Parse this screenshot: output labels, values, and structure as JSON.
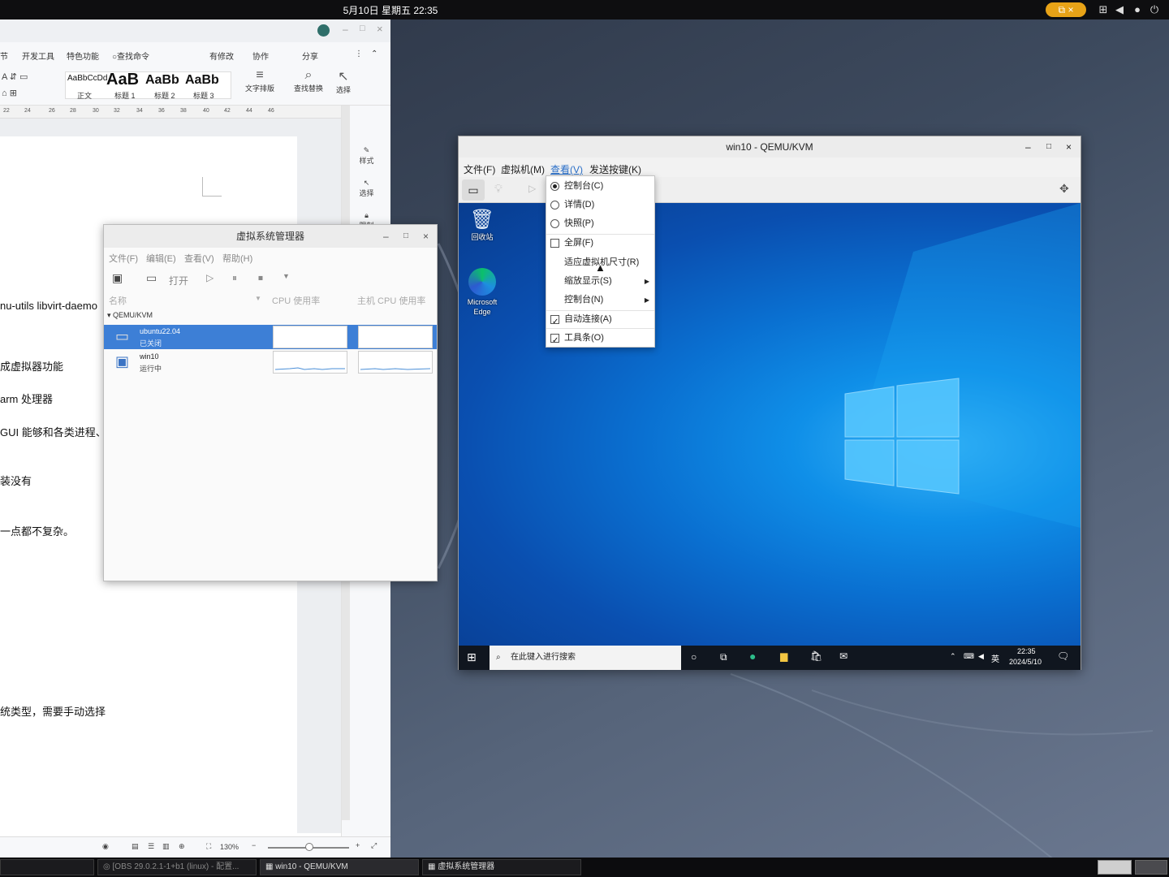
{
  "topbar": {
    "clock": "5月10日 星期五  22:35",
    "rec_icon": "screen-record-icon",
    "rec_close": "×"
  },
  "writer": {
    "menu": [
      "节",
      "开发工具",
      "特色功能",
      "查找命令",
      "有修改",
      "协作",
      "分享"
    ],
    "styles": [
      "AaBbCcDd",
      "AaB",
      "AaBb",
      "AaBb"
    ],
    "style_labels": [
      "正文",
      "标题 1",
      "标题 2",
      "标题 3"
    ],
    "tools": [
      "文字排版",
      "查找替换",
      "选择"
    ],
    "ruler": [
      "22",
      "24",
      "26",
      "28",
      "30",
      "32",
      "34",
      "36",
      "38",
      "40",
      "42",
      "44",
      "46"
    ],
    "side": [
      "样式",
      "选择",
      "限制"
    ],
    "lines": [
      "nu-utils libvirt-daemo",
      "成虚拟器功能",
      "arm 处理器",
      "GUI 能够和各类进程、",
      "装没有",
      "一点都不复杂。",
      "统类型，需要手动选择"
    ],
    "zoom": "130%"
  },
  "vmm": {
    "title": "虚拟系统管理器",
    "menu": [
      "文件(F)",
      "编辑(E)",
      "查看(V)",
      "帮助(H)"
    ],
    "open_label": "打开",
    "cols": [
      "名称",
      "CPU 使用率",
      "主机 CPU 使用率"
    ],
    "group": "QEMU/KVM",
    "vms": [
      {
        "name": "ubuntu22.04",
        "status": "已关闭"
      },
      {
        "name": "win10",
        "status": "运行中"
      }
    ]
  },
  "qemu": {
    "title": "win10 - QEMU/KVM",
    "menu": [
      "文件(F)",
      "虚拟机(M)",
      "查看(V)",
      "发送按键(K)"
    ],
    "view_menu": [
      {
        "label": "控制台(C)",
        "type": "radio",
        "on": true
      },
      {
        "label": "详情(D)",
        "type": "radio",
        "on": false
      },
      {
        "label": "快照(P)",
        "type": "radio",
        "on": false
      },
      {
        "label": "全屏(F)",
        "type": "check",
        "on": false
      },
      {
        "label": "适应虚拟机尺寸(R)",
        "type": "plain"
      },
      {
        "label": "缩放显示(S)",
        "type": "submenu"
      },
      {
        "label": "控制台(N)",
        "type": "submenu"
      },
      {
        "label": "自动连接(A)",
        "type": "check",
        "on": true
      },
      {
        "label": "工具条(O)",
        "type": "check",
        "on": true
      }
    ]
  },
  "win": {
    "recycle": "回收站",
    "edge": "Microsoft Edge",
    "search": "在此键入进行搜索",
    "ime": "英",
    "time": "22:35",
    "date": "2024/5/10"
  },
  "taskbar": {
    "items": [
      "[OBS 29.0.2.1-1+b1 (linux) - 配置...",
      "win10 - QEMU/KVM",
      "虚拟系统管理器"
    ]
  }
}
